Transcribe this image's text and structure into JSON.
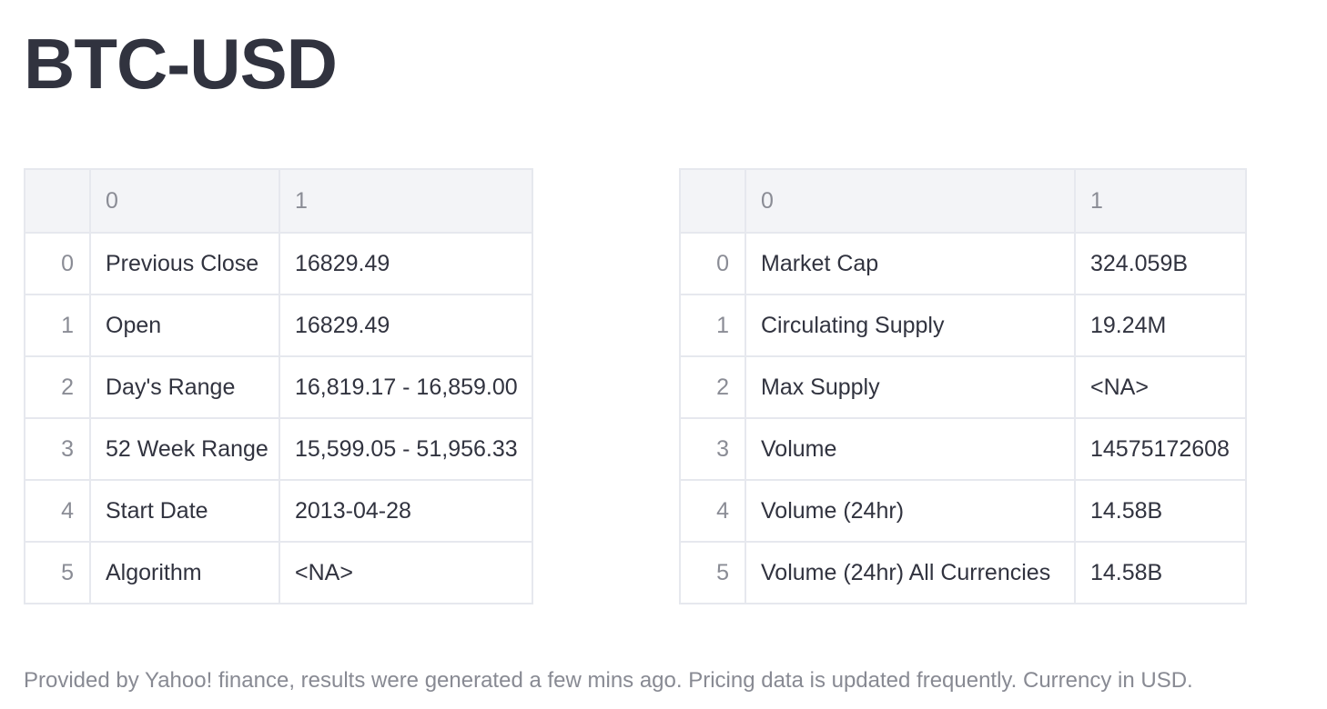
{
  "title": "BTC-USD",
  "left_table": {
    "headers": [
      "",
      "0",
      "1"
    ],
    "rows": [
      {
        "index": "0",
        "label": "Previous Close",
        "value": "16829.49"
      },
      {
        "index": "1",
        "label": "Open",
        "value": "16829.49"
      },
      {
        "index": "2",
        "label": "Day's Range",
        "value": "16,819.17 - 16,859.00"
      },
      {
        "index": "3",
        "label": "52 Week Range",
        "value": "15,599.05 - 51,956.33"
      },
      {
        "index": "4",
        "label": "Start Date",
        "value": "2013-04-28"
      },
      {
        "index": "5",
        "label": "Algorithm",
        "value": "<NA>"
      }
    ]
  },
  "right_table": {
    "headers": [
      "",
      "0",
      "1"
    ],
    "rows": [
      {
        "index": "0",
        "label": "Market Cap",
        "value": "324.059B"
      },
      {
        "index": "1",
        "label": "Circulating Supply",
        "value": "19.24M"
      },
      {
        "index": "2",
        "label": "Max Supply",
        "value": "<NA>"
      },
      {
        "index": "3",
        "label": "Volume",
        "value": "14575172608"
      },
      {
        "index": "4",
        "label": "Volume (24hr)",
        "value": "14.58B"
      },
      {
        "index": "5",
        "label": "Volume (24hr) All Currencies",
        "value": "14.58B"
      }
    ]
  },
  "footer": "Provided by Yahoo! finance, results were generated a few mins ago. Pricing data is updated frequently. Currency in USD."
}
